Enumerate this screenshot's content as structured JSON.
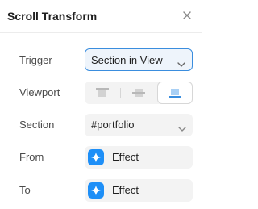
{
  "panel": {
    "title": "Scroll Transform",
    "close_icon": "close-icon"
  },
  "trigger": {
    "label": "Trigger",
    "value": "Section in View",
    "icon": "chevron-down-icon",
    "accent": "#3a8dde"
  },
  "viewport": {
    "label": "Viewport",
    "options": [
      {
        "icon": "align-top-icon",
        "selected": false
      },
      {
        "icon": "align-center-icon",
        "selected": false
      },
      {
        "icon": "align-bottom-icon",
        "selected": true
      }
    ],
    "selected_color": "#3a8dde"
  },
  "section": {
    "label": "Section",
    "value": "#portfolio",
    "icon": "chevron-down-icon"
  },
  "from": {
    "label": "From",
    "value": "Effect",
    "icon": "sparkle-icon",
    "badge_color": "#1e8ff7"
  },
  "to": {
    "label": "To",
    "value": "Effect",
    "icon": "sparkle-icon",
    "badge_color": "#1e8ff7"
  }
}
